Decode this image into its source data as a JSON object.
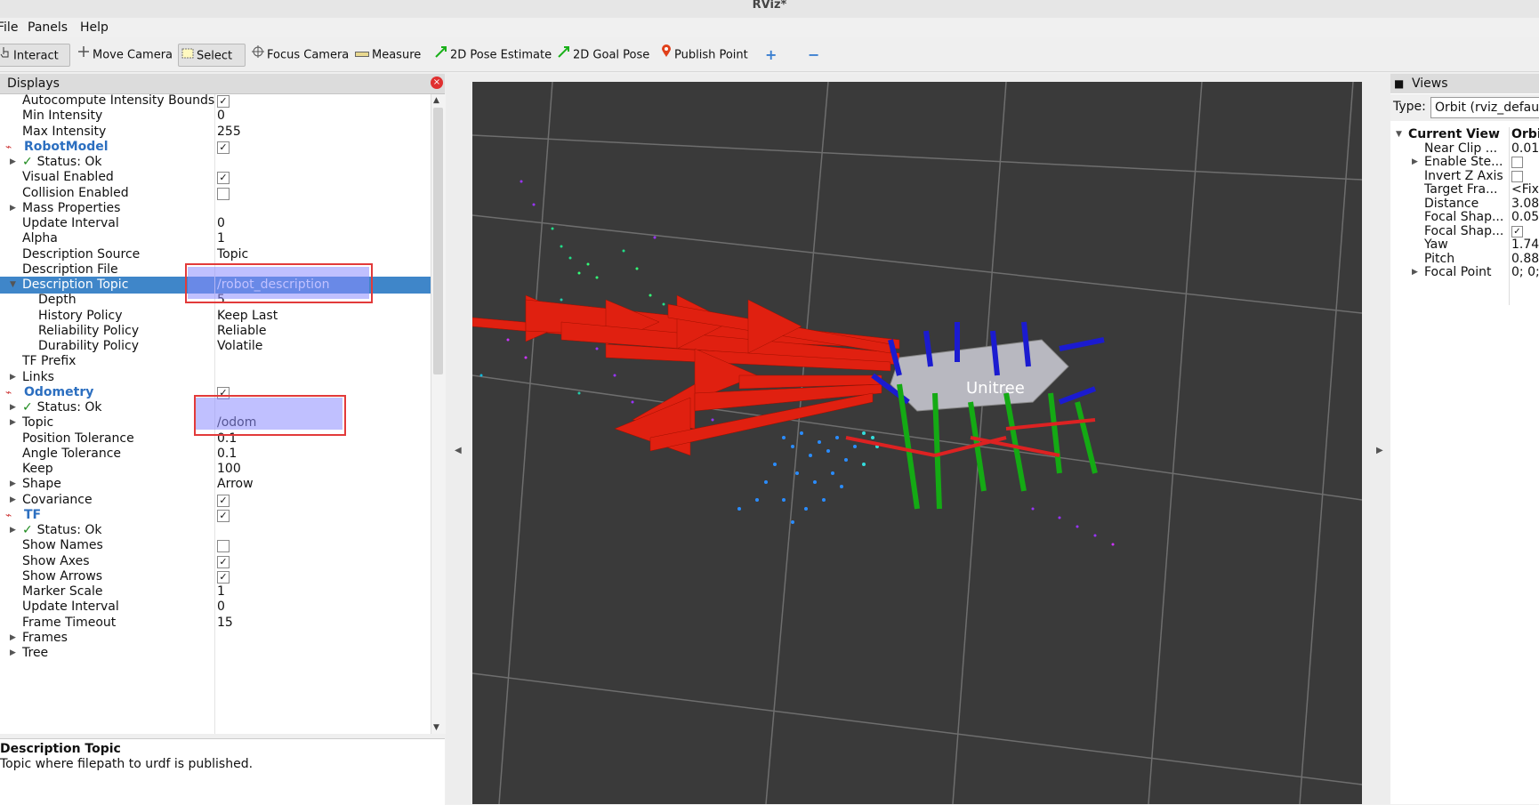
{
  "window": {
    "title": "RViz*"
  },
  "menu": {
    "file": "File",
    "panels": "Panels",
    "help": "Help"
  },
  "toolbar": {
    "interact": "Interact",
    "move_camera": "Move Camera",
    "select": "Select",
    "focus_camera": "Focus Camera",
    "measure": "Measure",
    "pose_estimate": "2D Pose Estimate",
    "goal_pose": "2D Goal Pose",
    "publish_point": "Publish Point",
    "add_tool": "+",
    "remove_tool": "−"
  },
  "displays": {
    "title": "Displays",
    "rows": [
      {
        "label": "Autocompute Intensity Bounds",
        "value": "",
        "checked": true
      },
      {
        "label": "Min Intensity",
        "value": "0"
      },
      {
        "label": "Max Intensity",
        "value": "255"
      },
      {
        "label": "RobotModel",
        "value": "",
        "checked": true,
        "kind": "display"
      },
      {
        "label": "Status: Ok",
        "kind": "status",
        "arrow": true
      },
      {
        "label": "Visual Enabled",
        "value": "",
        "checked": true
      },
      {
        "label": "Collision Enabled",
        "value": "",
        "checked": false
      },
      {
        "label": "Mass Properties",
        "value": "",
        "arrow": true
      },
      {
        "label": "Update Interval",
        "value": "0"
      },
      {
        "label": "Alpha",
        "value": "1"
      },
      {
        "label": "Description Source",
        "value": "Topic"
      },
      {
        "label": "Description File",
        "value": ""
      },
      {
        "label": "Description Topic",
        "value": "/robot_description",
        "selected": true,
        "expanded": true
      },
      {
        "label": "Depth",
        "value": "5",
        "indent": 2
      },
      {
        "label": "History Policy",
        "value": "Keep Last",
        "indent": 2
      },
      {
        "label": "Reliability Policy",
        "value": "Reliable",
        "indent": 2
      },
      {
        "label": "Durability Policy",
        "value": "Volatile",
        "indent": 2
      },
      {
        "label": "TF Prefix",
        "value": ""
      },
      {
        "label": "Links",
        "value": "",
        "arrow": true
      },
      {
        "label": "Odometry",
        "value": "",
        "checked": true,
        "kind": "display"
      },
      {
        "label": "Status: Ok",
        "kind": "status",
        "arrow": true
      },
      {
        "label": "Topic",
        "value": "/odom",
        "arrow": true
      },
      {
        "label": "Position Tolerance",
        "value": "0.1"
      },
      {
        "label": "Angle Tolerance",
        "value": "0.1"
      },
      {
        "label": "Keep",
        "value": "100"
      },
      {
        "label": "Shape",
        "value": "Arrow",
        "arrow": true
      },
      {
        "label": "Covariance",
        "value": "",
        "checked": true,
        "arrow": true
      },
      {
        "label": "TF",
        "value": "",
        "checked": true,
        "kind": "display"
      },
      {
        "label": "Status: Ok",
        "kind": "status",
        "arrow": true
      },
      {
        "label": "Show Names",
        "value": "",
        "checked": false
      },
      {
        "label": "Show Axes",
        "value": "",
        "checked": true
      },
      {
        "label": "Show Arrows",
        "value": "",
        "checked": true
      },
      {
        "label": "Marker Scale",
        "value": "1"
      },
      {
        "label": "Update Interval",
        "value": "0"
      },
      {
        "label": "Frame Timeout",
        "value": "15"
      },
      {
        "label": "Frames",
        "value": "",
        "arrow": true
      },
      {
        "label": "Tree",
        "value": "",
        "arrow": true
      }
    ]
  },
  "description": {
    "title": "Description Topic",
    "text": "Topic where filepath to urdf is published."
  },
  "viewport": {
    "robot_label": "Unitree"
  },
  "views": {
    "title": "Views",
    "type_label": "Type:",
    "type_value": "Orbit (rviz_default",
    "rows": [
      {
        "label": "Current View",
        "value": "Orbit",
        "header": true
      },
      {
        "label": "Near Clip ...",
        "value": "0.01"
      },
      {
        "label": "Enable Ste...",
        "value": "",
        "checked": false,
        "arrow": true
      },
      {
        "label": "Invert Z Axis",
        "value": "",
        "checked": false
      },
      {
        "label": "Target Fra...",
        "value": "<Fixed"
      },
      {
        "label": "Distance",
        "value": "3.08"
      },
      {
        "label": "Focal Shap...",
        "value": "0.05"
      },
      {
        "label": "Focal Shap...",
        "value": "",
        "checked": true
      },
      {
        "label": "Yaw",
        "value": "1.74"
      },
      {
        "label": "Pitch",
        "value": "0.88"
      },
      {
        "label": "Focal Point",
        "value": "0; 0;",
        "arrow": true
      }
    ]
  },
  "colors": {
    "selection": "#3f86c9",
    "display_name": "#2c6fc0",
    "status_ok": "#1d8a1d",
    "viewport_bg": "#3a3a3a",
    "odometry_arrow": "#e02010"
  }
}
